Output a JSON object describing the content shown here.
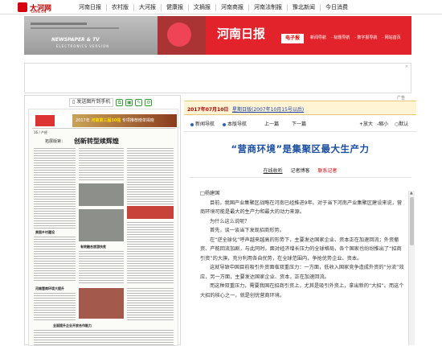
{
  "site": {
    "logo_text": "大河网",
    "logo_sub": "DAHE.CN"
  },
  "topnav": [
    "河南日报",
    "农村版",
    "大河报",
    "健康报",
    "文摘报",
    "河南商报",
    "河南法制报",
    "豫北新闻",
    "今日消费"
  ],
  "banner": {
    "en_title": "NEWSPAPER & TV",
    "en_sub": "ELECTRONICS VERSION",
    "title": "河南日报",
    "tag": "电子报",
    "links": [
      "新闻导航",
      "· 标题导航",
      "· 数字报导航",
      "· 网站首页"
    ]
  },
  "ad_label": "广告",
  "left_toolbar": {
    "share": "发送图片到手机"
  },
  "paper": {
    "ad_text": "2017年",
    "ad_highlight": "河南第三届30强",
    "ad_tail": "专项推荐榜单揭晓",
    "meta": "16 / 产经",
    "section_label": "·新闻·",
    "headline_small": "拓展版第：",
    "headline": "创新转型续辉煌",
    "captions": [
      "美丽乡村建设",
      "有效融合旅游扶贫",
      "河南营商环境大提升",
      "全面提升企业开放合作能力"
    ]
  },
  "right": {
    "date": "2017年07月10日",
    "date_link": "星期日版(2007年10月15号以后)",
    "controls": {
      "prev_nav": "新闻导航",
      "this_nav": "本版导航",
      "prev": "上一篇",
      "next": "下一篇",
      "bigger": "放大",
      "smaller": "缩小",
      "default": "默认"
    },
    "title": "“营商环境”是集聚区最大生产力",
    "tools": {
      "listen": "在线收听",
      "share": "记者博客",
      "reporter": "联系记者"
    },
    "body": [
      "□杨建国",
      "目前，我国产业集聚区战略在河南已经推进9年。对于当下河南产业集聚区建设来说，营商环境可能是最大的生产力和最大的动力来源。",
      "为什么这么说呢？",
      "首先，谈一谈当下发现招商形势。",
      "在“逆全球化”呼声越来越高的形势下，主要发达国家企业、资本正在加速回流；外资撤资、产能回流加剧，与此同时，面对经济增长压力的全球格局，各个国家也纷纷推出了“招商引资”的大旗，充分利用各自优势，在全球范围内，争抢优势企业、资本。",
      "这就导致中国目前吸引外资面临双重压力：一方面，低收入国家竞争造成外资的“分流”效应，另一方面，主要发达国家企业、资本，正在加速回流。",
      "而这种双重压力，需要我国在招商引资上，尤其是吸引外资上，拿出新的“大招”。而这个大招的核心之一，就是创优营商环境。"
    ]
  }
}
